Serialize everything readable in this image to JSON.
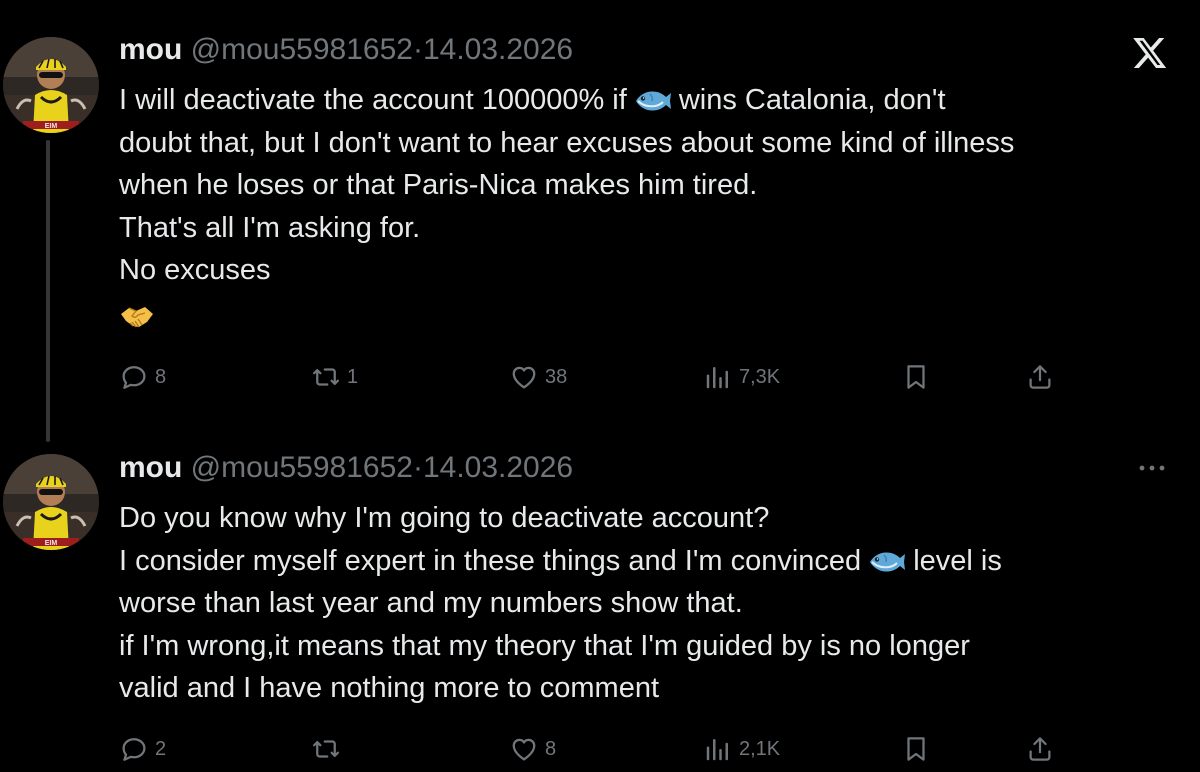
{
  "tweets": [
    {
      "author": {
        "name": "mou",
        "handle": "@mou55981652",
        "separator": "·",
        "date": "14.03.2026"
      },
      "body_lines": [
        "I will deactivate the account 100000% if",
        "wins Catalonia, don't",
        "doubt that, but I don't want to hear excuses about some kind of illness",
        "when he loses or that Paris-Nica makes him tired.",
        "That's all I'm asking for.",
        "No excuses"
      ],
      "inline_emoji": "fish-icon",
      "trailing_emoji": "handshake-icon",
      "corner_icon": "x-logo-icon",
      "stats": {
        "replies": "8",
        "reposts": "1",
        "likes": "38",
        "views": "7,3K"
      }
    },
    {
      "author": {
        "name": "mou",
        "handle": "@mou55981652",
        "separator": "·",
        "date": "14.03.2026"
      },
      "body_lines": [
        "Do you know why I'm going to deactivate account?",
        "I consider myself expert in these things and I'm convinced",
        "level is",
        "worse than last year and  my numbers show that.",
        "if I'm wrong,it means that my theory that I'm guided by is no longer",
        "valid and I have nothing more to comment"
      ],
      "inline_emoji": "fish-icon",
      "corner_icon": "more-options-icon",
      "stats": {
        "replies": "2",
        "reposts": "",
        "likes": "8",
        "views": "2,1K"
      }
    }
  ],
  "colors": {
    "background": "#000000",
    "text_primary": "#e7e9ea",
    "text_secondary": "#71767b",
    "thread_line": "#333639"
  }
}
